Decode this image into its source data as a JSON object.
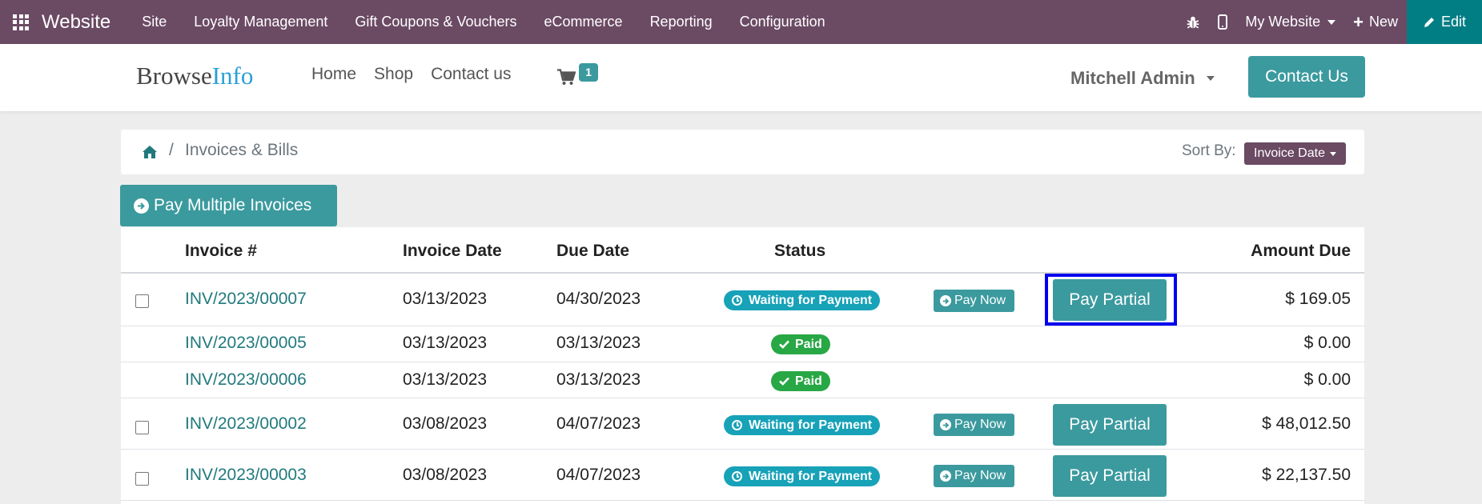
{
  "topbar": {
    "brand": "Website",
    "menu": [
      "Site",
      "Loyalty Management",
      "Gift Coupons & Vouchers",
      "eCommerce",
      "Reporting",
      "Configuration"
    ],
    "website_selector": "My Website",
    "new_label": "New",
    "edit_label": "Edit"
  },
  "site": {
    "logo_part1": "Browse",
    "logo_part2": "Info",
    "nav": [
      "Home",
      "Shop",
      "Contact us"
    ],
    "cart_count": "1",
    "user": "Mitchell Admin",
    "contact_button": "Contact Us"
  },
  "breadcrumb": {
    "separator": "/",
    "current": "Invoices & Bills",
    "sort_label": "Sort By:",
    "sort_value": "Invoice Date"
  },
  "pay_multiple_label": "Pay Multiple Invoices",
  "table": {
    "headers": {
      "invoice": "Invoice #",
      "invoice_date": "Invoice Date",
      "due_date": "Due Date",
      "status": "Status",
      "amount_due": "Amount Due"
    },
    "pay_now_label": "Pay Now",
    "pay_partial_label": "Pay Partial",
    "rows": [
      {
        "invoice": "INV/2023/00007",
        "invoice_date": "03/13/2023",
        "due_date": "04/30/2023",
        "status": "Waiting for Payment",
        "amount": "$ 169.05"
      },
      {
        "invoice": "INV/2023/00005",
        "invoice_date": "03/13/2023",
        "due_date": "03/13/2023",
        "status": "Paid",
        "amount": "$ 0.00"
      },
      {
        "invoice": "INV/2023/00006",
        "invoice_date": "03/13/2023",
        "due_date": "03/13/2023",
        "status": "Paid",
        "amount": "$ 0.00"
      },
      {
        "invoice": "INV/2023/00002",
        "invoice_date": "03/08/2023",
        "due_date": "04/07/2023",
        "status": "Waiting for Payment",
        "amount": "$ 48,012.50"
      },
      {
        "invoice": "INV/2023/00003",
        "invoice_date": "03/08/2023",
        "due_date": "04/07/2023",
        "status": "Waiting for Payment",
        "amount": "$ 22,137.50"
      }
    ]
  },
  "colors": {
    "topbar": "#6b4a64",
    "edit": "#017e84",
    "primary": "#3b9a9e",
    "link": "#21797d",
    "waiting_badge": "#17a2b8",
    "paid_badge": "#28a745",
    "highlight": "#0000ee"
  }
}
